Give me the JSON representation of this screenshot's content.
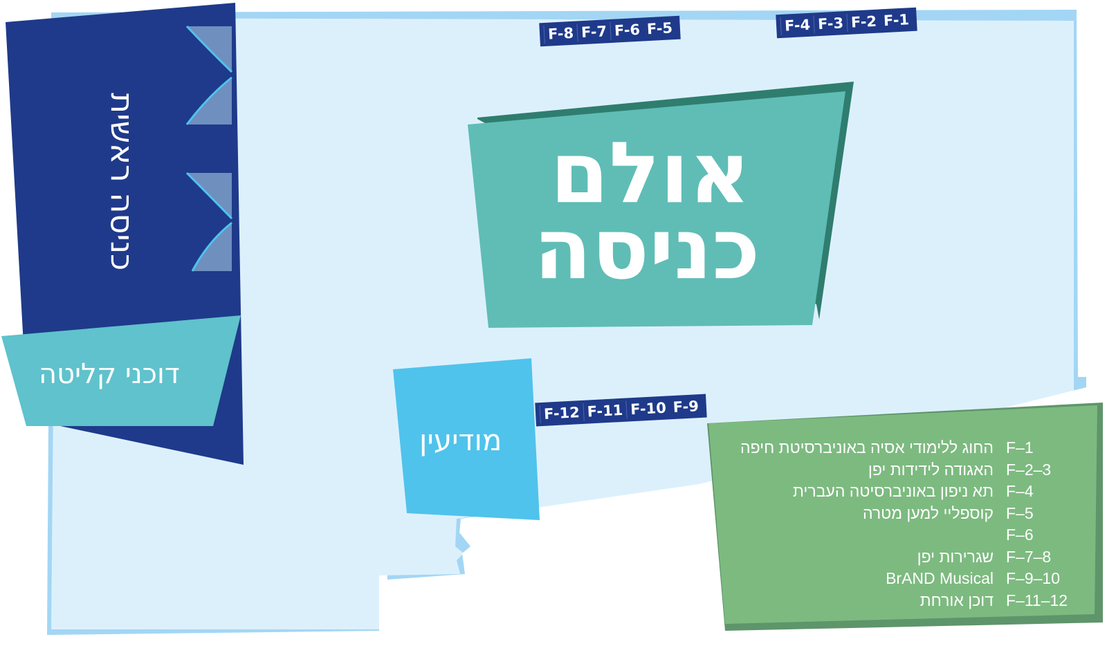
{
  "map": {
    "colors": {
      "floor": "#dcf0fc",
      "floor_edge": "#a3d6f4",
      "main_entrance": "#1f3a8a",
      "reception": "#5fc2cc",
      "hall": "#5fbdb6",
      "hall_shadow": "#2f7d6e",
      "info": "#4fc3ec",
      "legend": "#7dba80",
      "legend_shadow": "#5e956a"
    },
    "main_entrance_label": "כניסה ראשית",
    "reception_label": "דוכני קליטה",
    "hall_title_line1": "אולם",
    "hall_title_line2": "כניסה",
    "info_label": "מודיעין",
    "booth_groups": {
      "top_right": [
        "F-4",
        "F-3",
        "F-2",
        "F-1"
      ],
      "top_middle": [
        "F-8",
        "F-7",
        "F-6",
        "F-5"
      ],
      "middle": [
        "F-12",
        "F-11",
        "F-10",
        "F-9"
      ]
    },
    "legend": [
      {
        "code": "F–1",
        "name": "החוג ללימודי אסיה באוניברסיטת חיפה"
      },
      {
        "code": "F–2–3",
        "name": "האגודה לידידות יפן"
      },
      {
        "code": "F–4",
        "name": "תא ניפון באוניברסיטה העברית"
      },
      {
        "code": "F–5",
        "name": "קוספליי למען מטרה"
      },
      {
        "code": "F–6",
        "name": ""
      },
      {
        "code": "F–7–8",
        "name": "שגרירות יפן"
      },
      {
        "code": "F–9–10",
        "name": "BrAND Musical"
      },
      {
        "code": "F–11–12",
        "name": "דוכן אורחת"
      }
    ]
  }
}
